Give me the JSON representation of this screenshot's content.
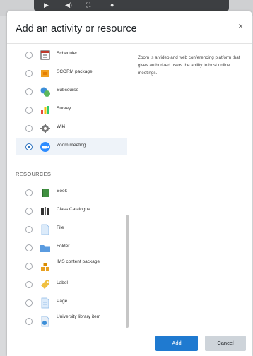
{
  "modal": {
    "title": "Add an activity or resource",
    "close_glyph": "×"
  },
  "activities": [
    {
      "label": "Scheduler",
      "icon": "scheduler-icon",
      "selected": false
    },
    {
      "label": "SCORM package",
      "icon": "scorm-package-icon",
      "selected": false
    },
    {
      "label": "Subcourse",
      "icon": "subcourse-icon",
      "selected": false
    },
    {
      "label": "Survey",
      "icon": "survey-icon",
      "selected": false
    },
    {
      "label": "Wiki",
      "icon": "wiki-icon",
      "selected": false
    },
    {
      "label": "Zoom meeting",
      "icon": "zoom-icon",
      "selected": true
    }
  ],
  "resources_heading": "RESOURCES",
  "resources": [
    {
      "label": "Book",
      "icon": "book-icon"
    },
    {
      "label": "Class Catalogue",
      "icon": "class-catalogue-icon"
    },
    {
      "label": "File",
      "icon": "file-icon"
    },
    {
      "label": "Folder",
      "icon": "folder-icon"
    },
    {
      "label": "IMS content package",
      "icon": "ims-content-package-icon"
    },
    {
      "label": "Label",
      "icon": "label-icon"
    },
    {
      "label": "Page",
      "icon": "page-icon"
    },
    {
      "label": "University library item",
      "icon": "university-library-item-icon"
    }
  ],
  "description": "Zoom is a video and web conferencing platform that gives authorized users the ability to host online meetings.",
  "footer": {
    "add_label": "Add",
    "cancel_label": "Cancel"
  },
  "colors": {
    "accent": "#1f7ad0",
    "cancel_bg": "#ced4da"
  }
}
